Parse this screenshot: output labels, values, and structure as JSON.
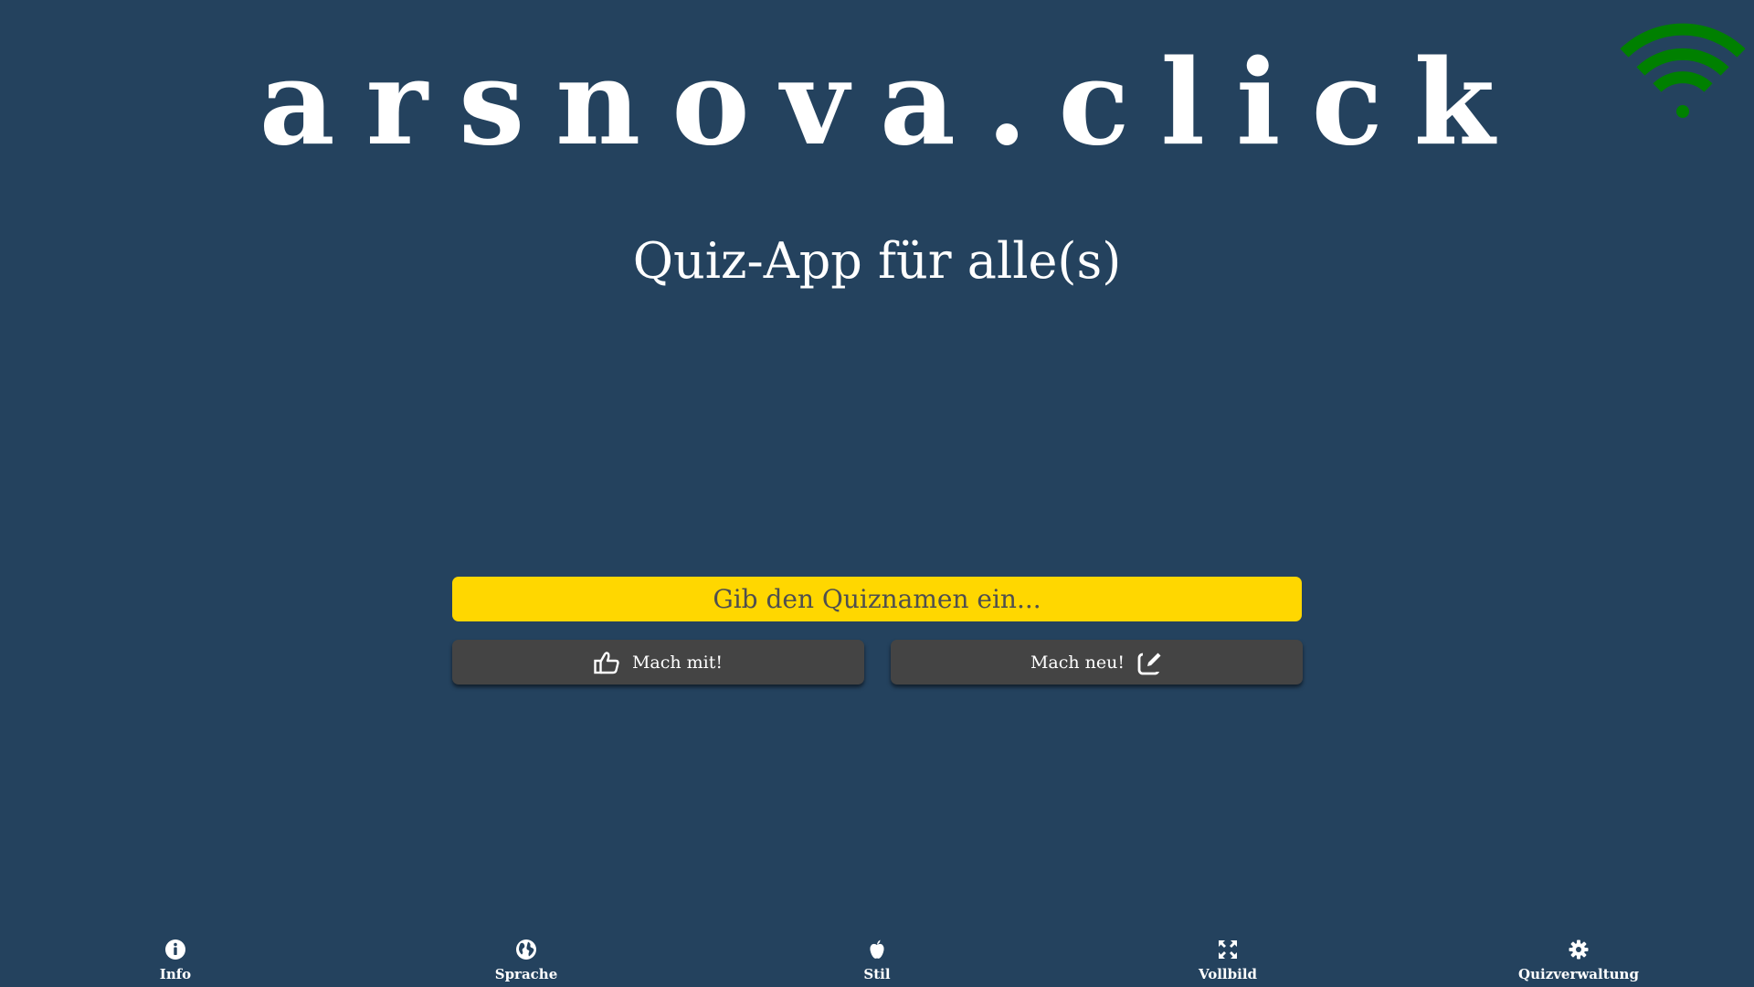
{
  "header": {
    "brand": "arsnova.click",
    "subtitle": "Quiz-App für alle(s)"
  },
  "status": {
    "connection_icon": "wifi-icon",
    "connection_color": "#008000"
  },
  "quiz_entry": {
    "placeholder": "Gib den Quiznamen ein...",
    "value": ""
  },
  "actions": {
    "join_label": "Mach mit!",
    "join_icon": "thumbs-up-icon",
    "create_label": "Mach neu!",
    "create_icon": "edit-icon"
  },
  "footer": {
    "items": [
      {
        "label": "Info",
        "icon": "info-icon"
      },
      {
        "label": "Sprache",
        "icon": "globe-icon"
      },
      {
        "label": "Stil",
        "icon": "apple-icon"
      },
      {
        "label": "Vollbild",
        "icon": "fullscreen-icon"
      },
      {
        "label": "Quizverwaltung",
        "icon": "gear-icon"
      }
    ]
  },
  "colors": {
    "background": "#24425e",
    "input_background": "#ffd700",
    "button_background": "#444444",
    "text": "#ffffff"
  }
}
